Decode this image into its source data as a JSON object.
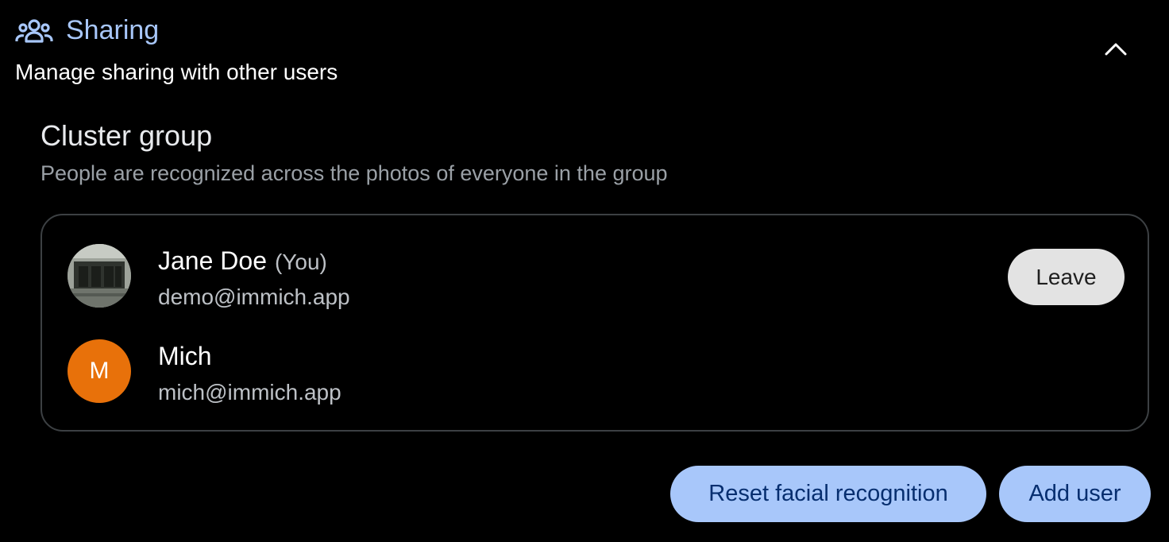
{
  "header": {
    "icon": "people-group-icon",
    "title": "Sharing",
    "subtitle": "Manage sharing with other users",
    "collapse_icon": "chevron-up-icon"
  },
  "section": {
    "title": "Cluster group",
    "description": "People are recognized across the photos of everyone in the group"
  },
  "members": [
    {
      "name": "Jane Doe",
      "tag": "(You)",
      "email": "demo@immich.app",
      "avatar": "photo-avatar",
      "action_label": "Leave"
    },
    {
      "name": "Mich",
      "email": "mich@immich.app",
      "avatar_letter": "M",
      "avatar_color": "#e8710a"
    }
  ],
  "actions": {
    "reset_label": "Reset facial recognition",
    "add_label": "Add user"
  },
  "colors": {
    "accent": "#a8c7fa",
    "background": "#000000",
    "avatar_orange": "#e8710a"
  }
}
